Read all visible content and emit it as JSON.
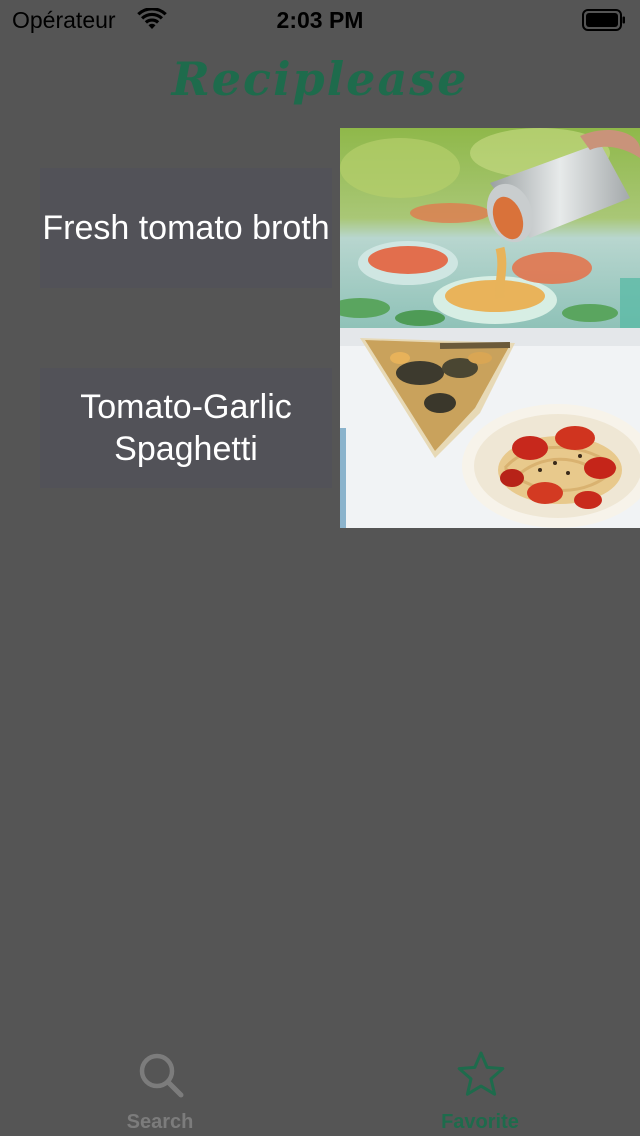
{
  "status_bar": {
    "carrier": "Opérateur",
    "time": "2:03 PM",
    "wifi_icon": "wifi-icon",
    "battery_icon": "battery-icon"
  },
  "nav": {
    "title": "Reciplease",
    "title_color": "#1e6b4c"
  },
  "recipes": [
    {
      "title": "Fresh tomato broth",
      "image_icon": "tomato-broth-photo"
    },
    {
      "title": "Tomato-Garlic Spaghetti",
      "image_icon": "spaghetti-photo"
    }
  ],
  "tab_bar": {
    "tabs": [
      {
        "label": "Search",
        "icon": "search-icon",
        "selected": false
      },
      {
        "label": "Favorite",
        "icon": "star-icon",
        "selected": true
      }
    ],
    "selected_color": "#1e6b4c",
    "unselected_color": "#7c7c7c"
  },
  "colors": {
    "background": "#555555",
    "cell_background": "#525258"
  }
}
